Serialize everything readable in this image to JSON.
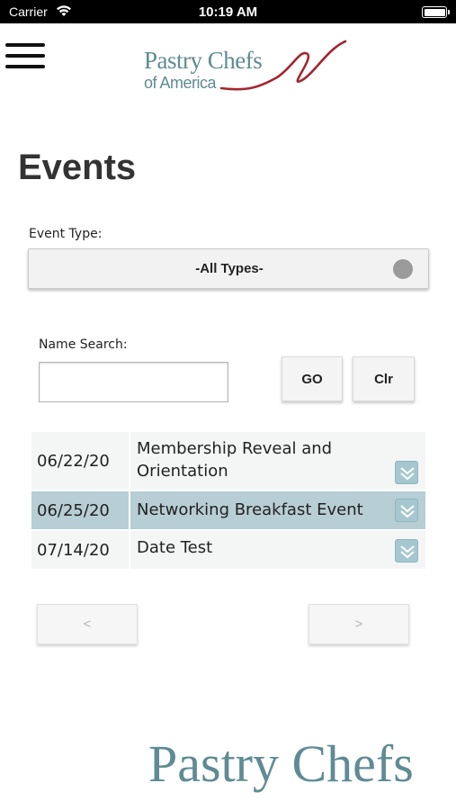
{
  "status_bar": {
    "carrier": "Carrier",
    "time": "10:19 AM"
  },
  "header": {
    "logo_line1": "Pastry Chefs",
    "logo_line2": "of America",
    "menu_icon": "hamburger-menu-icon"
  },
  "page": {
    "title": "Events"
  },
  "filters": {
    "event_type_label": "Event Type:",
    "event_type_value": "-All Types-",
    "name_search_label": "Name Search:",
    "name_search_value": "",
    "go_label": "GO",
    "clear_label": "Clr"
  },
  "events": [
    {
      "date": "06/22/20",
      "title": "Membership Reveal and Orientation"
    },
    {
      "date": "06/25/20",
      "title": "Networking Breakfast Event"
    },
    {
      "date": "07/14/20",
      "title": "Date Test"
    }
  ],
  "pager": {
    "prev_label": "<",
    "next_label": ">"
  },
  "footer": {
    "logo_text": "Pastry Chefs"
  },
  "colors": {
    "brand_teal": "#5f8b94",
    "brand_red": "#a3262f",
    "selected_row": "#b7ced4"
  }
}
